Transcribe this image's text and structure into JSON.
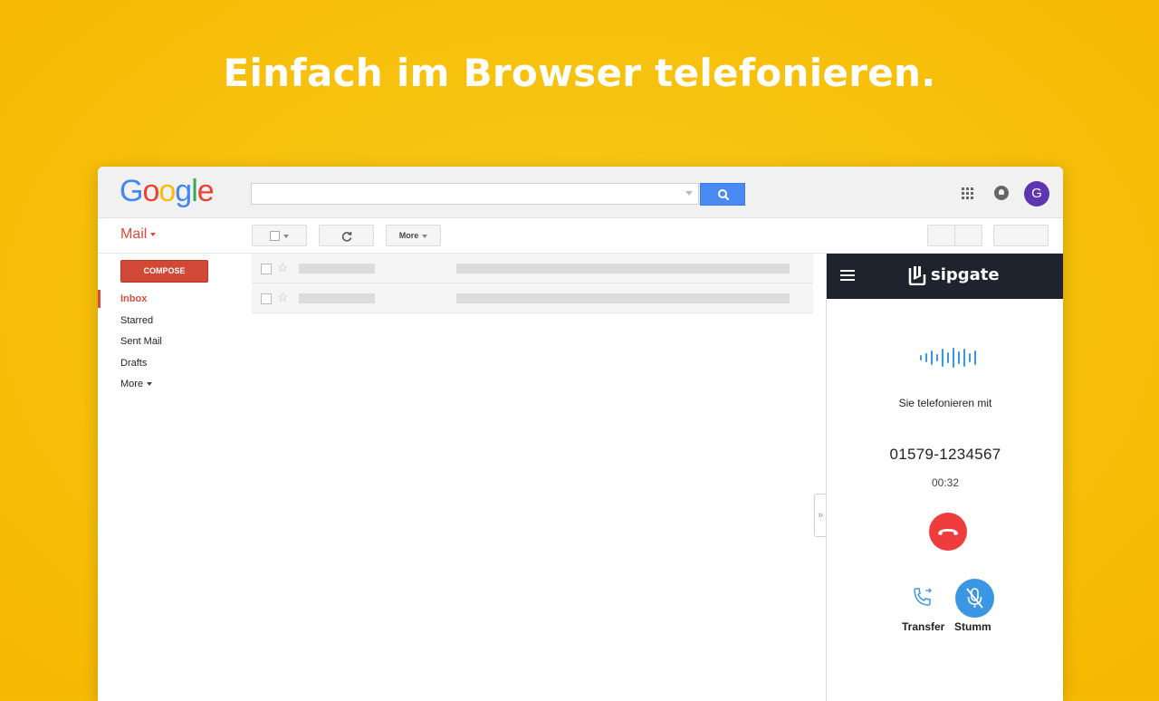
{
  "headline": "Einfach im Browser telefonieren.",
  "colors": {
    "accent": "#f7c10d",
    "gmail_red": "#dd4b39",
    "sipgate_blue": "#3b97e3",
    "hangup_red": "#ef3d3d",
    "panel_header": "#1e232d"
  },
  "gmail": {
    "logo_letters": [
      "G",
      "o",
      "o",
      "g",
      "l",
      "e"
    ],
    "logo_colors": [
      "#4285f4",
      "#ea4335",
      "#fbbc05",
      "#4285f4",
      "#34a853",
      "#ea4335"
    ],
    "search": {
      "value": "",
      "placeholder": ""
    },
    "avatar_initial": "G",
    "mail_label": "Mail",
    "toolbar": {
      "more_label": "More"
    },
    "compose_label": "COMPOSE",
    "nav": [
      "Inbox",
      "Starred",
      "Sent Mail",
      "Drafts",
      "More"
    ],
    "icons": {
      "search": "search-icon",
      "apps": "apps-grid-icon",
      "notifications": "bell-icon",
      "refresh": "refresh-icon",
      "expand": "double-chevron-right-icon"
    }
  },
  "sipgate": {
    "brand": "sipgate",
    "status_text": "Sie telefonieren mit",
    "phone_number": "01579-1234567",
    "duration": "00:32",
    "transfer_label": "Transfer",
    "mute_label": "Stumm",
    "icons": {
      "menu": "hamburger-icon",
      "wave": "audio-wave-icon",
      "hangup": "hangup-icon",
      "transfer": "phone-transfer-icon",
      "mute": "mic-off-icon"
    }
  }
}
